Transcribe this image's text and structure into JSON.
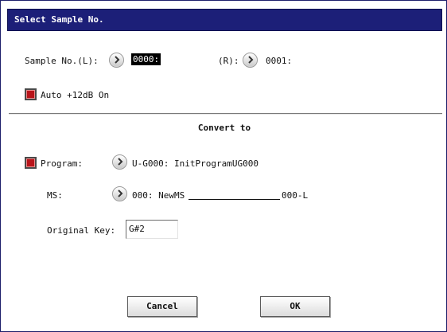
{
  "title": "Select Sample No.",
  "sample": {
    "left_label": "Sample No.(L):",
    "left_value": "0000:",
    "right_label": "(R):",
    "right_value": "0001:"
  },
  "auto_gain": {
    "label": "Auto +12dB On",
    "checked": true
  },
  "convert": {
    "section_title": "Convert to",
    "program_label": "Program:",
    "program_value": "U-G000: InitProgramUG000",
    "program_checked": true,
    "ms_label": "MS:",
    "ms_value_prefix": "000: NewMS",
    "ms_value_suffix": "000-L",
    "original_key_label": "Original Key:",
    "original_key_value": "G#2"
  },
  "buttons": {
    "cancel": "Cancel",
    "ok": "OK"
  },
  "icons": {
    "arrow": "chevron-right-icon",
    "checkbox": "checkbox-checked-icon"
  },
  "colors": {
    "titlebar": "#1c1f78",
    "checkbox": "#b8141a"
  }
}
